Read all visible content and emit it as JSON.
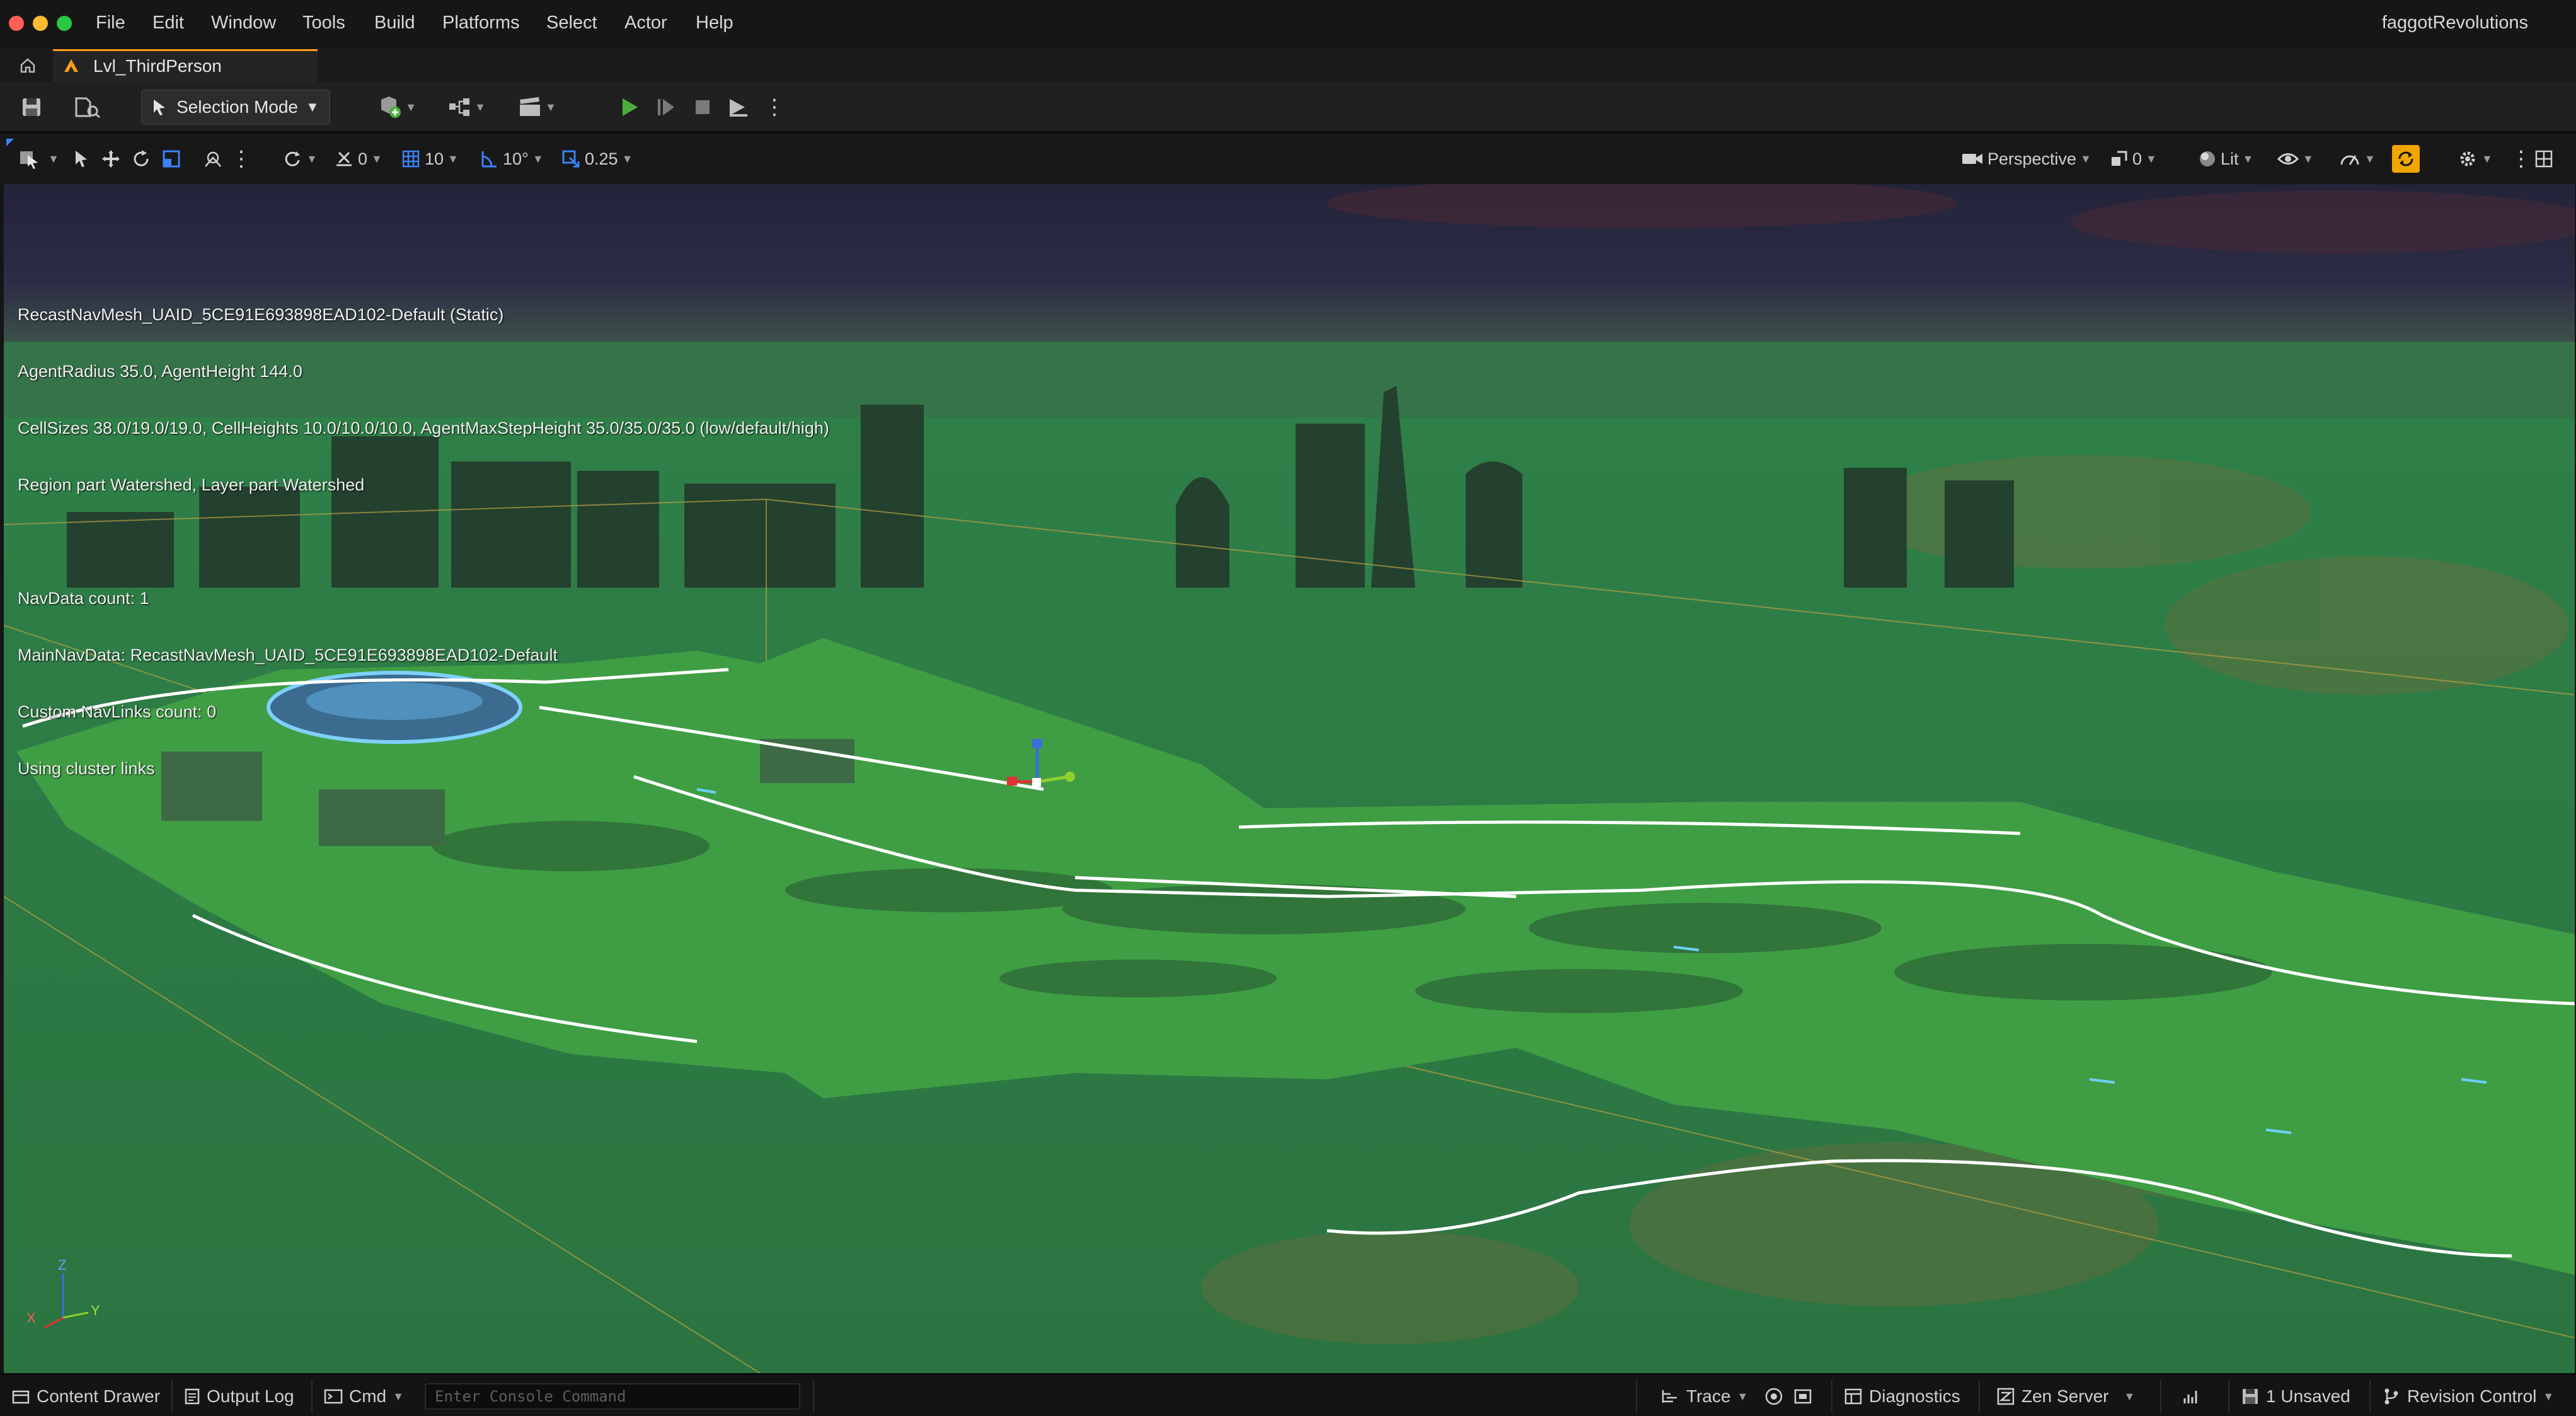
{
  "menu": {
    "items": [
      "File",
      "Edit",
      "Window",
      "Tools",
      "Build",
      "Platforms",
      "Select",
      "Actor",
      "Help"
    ],
    "project_name": "faggotRevolutions"
  },
  "tabs": {
    "level_tab": "Lvl_ThirdPerson"
  },
  "toolbar": {
    "selection_mode": "Selection Mode"
  },
  "viewport_toolbar": {
    "surface_snap": "0",
    "grid_snap": "10",
    "rotation_snap": "10°",
    "scale_snap": "0.25",
    "view_mode": "Perspective",
    "camera_speed": "0",
    "lighting": "Lit"
  },
  "viewport": {
    "nav_info": [
      "RecastNavMesh_UAID_5CE91E693898EAD102-Default (Static)",
      "AgentRadius 35.0, AgentHeight 144.0",
      "CellSizes 38.0/19.0/19.0, CellHeights 10.0/10.0/10.0, AgentMaxStepHeight 35.0/35.0/35.0 (low/default/high)",
      "Region part Watershed, Layer part Watershed",
      "",
      "NavData count: 1",
      "MainNavData: RecastNavMesh_UAID_5CE91E693898EAD102-Default",
      "Custom NavLinks count: 0",
      "Using cluster links"
    ],
    "axis": {
      "x": "X",
      "y": "Y",
      "z": "Z"
    }
  },
  "statusbar": {
    "content_drawer": "Content Drawer",
    "output_log": "Output Log",
    "cmd": "Cmd",
    "console_placeholder": "Enter Console Command",
    "trace": "Trace",
    "diagnostics": "Diagnostics",
    "zen_server": "Zen Server",
    "unsaved": "1 Unsaved",
    "revision_control": "Revision Control"
  },
  "colors": {
    "accent": "#ff9d1a",
    "play_green": "#4caf3c",
    "navmesh_green": "#3f9e44",
    "close_red": "#ff5f57",
    "minimize_yellow": "#febc2e",
    "zoom_green": "#28c840"
  }
}
